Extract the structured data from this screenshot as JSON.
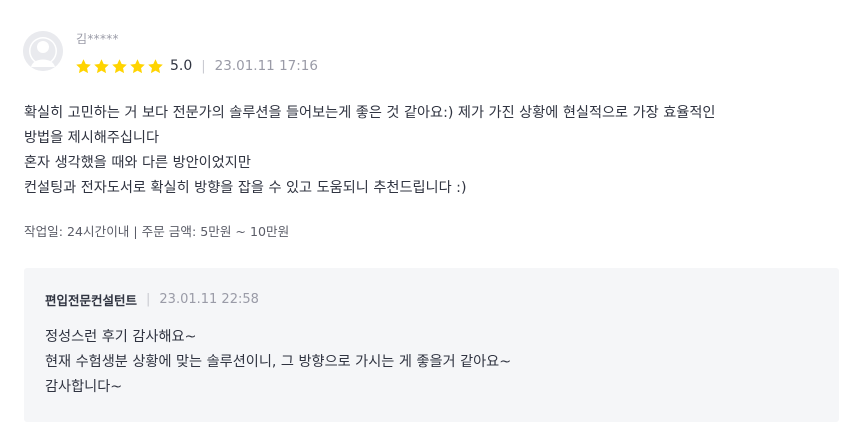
{
  "review": {
    "user_name": "김*****",
    "rating": "5.0",
    "stars": 5,
    "date": "23.01.11 17:16",
    "separator": "|",
    "body_lines": [
      "확실히 고민하는 거 보다 전문가의 솔루션을 들어보는게 좋은 것 같아요:)  제가 가진 상황에 현실적으로 가장 효율적인",
      "방법을 제시해주십니다",
      "혼자 생각했을 때와 다른 방안이었지만",
      "컨설팅과 전자도서로 확실히 방향을 잡을 수 있고 도움되니 추천드립니다 :)"
    ],
    "order_meta": "작업일: 24시간이내 | 주문 금액: 5만원 ~ 10만원"
  },
  "reply": {
    "author": "편입전문컨설턴트",
    "separator": "|",
    "date": "23.01.11 22:58",
    "body_lines": [
      "정성스런 후기 감사해요~",
      "현재 수험생분 상황에 맞는 솔루션이니, 그 방향으로 가시는 게 좋을거 같아요~",
      "감사합니다~"
    ]
  },
  "colors": {
    "star": "#ffd400",
    "text": "#303441",
    "muted": "#9a9ba7",
    "reply_bg": "#f5f6f8"
  },
  "icons": {
    "avatar": "default-user-avatar-icon",
    "star": "star-icon"
  }
}
